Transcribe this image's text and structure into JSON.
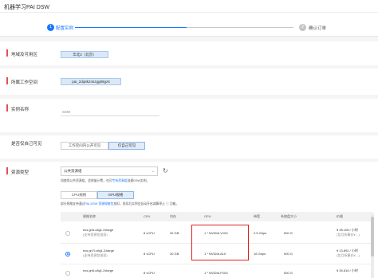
{
  "app": {
    "title": "机器学习PAI DSW"
  },
  "steps": [
    {
      "number": "1",
      "label": "配置实例"
    },
    {
      "number": "2",
      "label": "确认订单"
    }
  ],
  "region": {
    "label": "地域及可用区",
    "value": "华北2（北京）"
  },
  "workspace": {
    "label": "所属工作空间",
    "value": "pai_2dq8k24szgg89gz6"
  },
  "instance_name": {
    "label": "实例名称",
    "value": "SSW"
  },
  "visibility": {
    "label": "是否仅自己可见",
    "options": [
      "工作空间内公开可见",
      "仅自己可见"
    ],
    "selected": "仅自己可见"
  },
  "resource": {
    "label": "资源类型",
    "pool": "公共资源组",
    "hint_prefix": "如使用公共资源组，会按量计费，也可",
    "hint_link": "专有资源组",
    "hint_suffix": "创建DSW实例。",
    "tabs": [
      "CPU规格",
      "GPU规格"
    ],
    "selected_tab": "GPU规格",
    "note_prefix": "部分规格支持通过",
    "note_link": "PAI-DSW 资源规格包",
    "note_suffix": "抵扣，抵扣后实例会自动开启减算停止 ⓘ 功能。"
  },
  "table": {
    "columns": [
      "规格名称",
      "CPU",
      "内存",
      "GPU",
      "带宽",
      "系统盘大小",
      "价格"
    ],
    "rows": [
      {
        "name": "ecs.gn5-c8g1.2xlarge",
        "sub": "(支持资源包抵扣)",
        "cpu": "8 vCPU",
        "mem": "32 GB",
        "gpu": "1 * NVIDIA V100",
        "bw": "2.5 Gbps",
        "disk": "500 G",
        "price": "¥ 28.106 / 小时",
        "price_sub": "(包月折算价¥…)",
        "selected": false
      },
      {
        "name": "ecs.gn7i-c8g1.2xlarge",
        "sub": "(支持资源包抵扣)",
        "cpu": "8 vCPU",
        "mem": "30 GB",
        "gpu": "1 * NVIDIA A10",
        "bw": "16 Gbps",
        "disk": "500 G",
        "price": "¥ 13.892 / 小时",
        "price_sub": "(包月折算价¥…)",
        "selected": true
      },
      {
        "name": "ecs.gn6-c8g1.2xlarge",
        "sub": "",
        "cpu": "8 vCPU",
        "mem": "",
        "gpu": "1 * NVIDIA P100",
        "bw": "",
        "disk": "500 G",
        "price": "¥ 26.816 / 小时",
        "price_sub": "",
        "selected": false
      }
    ]
  },
  "colors": {
    "accent": "#1677ff",
    "required_bar": "#e05252",
    "highlight": "#e02020"
  }
}
